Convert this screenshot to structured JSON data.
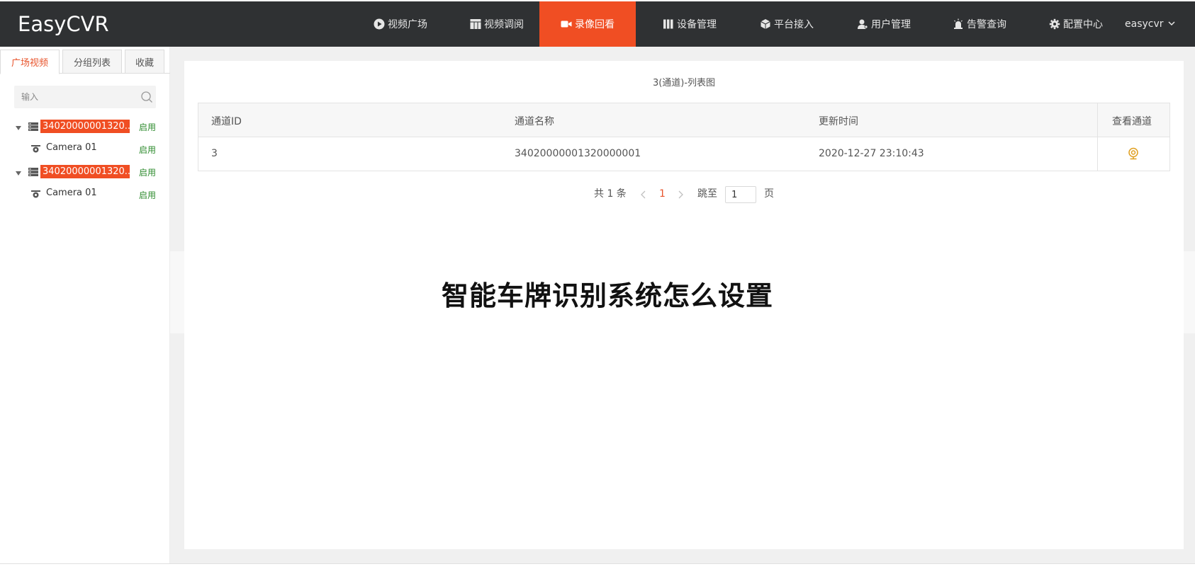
{
  "app": {
    "logo": "EasyCVR"
  },
  "nav": {
    "items": [
      {
        "label": "视频广场",
        "icon": "play-circle-icon"
      },
      {
        "label": "视频调阅",
        "icon": "grid-icon"
      },
      {
        "label": "录像回看",
        "icon": "video-camera-icon",
        "active": true
      },
      {
        "label": "设备管理",
        "icon": "columns-icon"
      },
      {
        "label": "平台接入",
        "icon": "cube-icon"
      },
      {
        "label": "用户管理",
        "icon": "user-icon"
      },
      {
        "label": "告警查询",
        "icon": "alarm-icon"
      },
      {
        "label": "配置中心",
        "icon": "gear-icon"
      }
    ],
    "user": "easycvr"
  },
  "sidebar": {
    "tabs": [
      {
        "label": "广场视频",
        "active": true
      },
      {
        "label": "分组列表"
      },
      {
        "label": "收藏"
      }
    ],
    "search_placeholder": "输入",
    "tree": [
      {
        "type": "device",
        "label": "34020000001320...",
        "status": "启用"
      },
      {
        "type": "camera",
        "label": "Camera 01",
        "status": "启用"
      },
      {
        "type": "device",
        "label": "34020000001320...",
        "status": "启用"
      },
      {
        "type": "camera",
        "label": "Camera 01",
        "status": "启用"
      }
    ]
  },
  "main": {
    "title": "3(通道)-列表图",
    "table": {
      "headers": [
        "通道ID",
        "通道名称",
        "更新时间",
        "查看通道"
      ],
      "rows": [
        {
          "id": "3",
          "name": "34020000001320000001",
          "updated": "2020-12-27 23:10:43",
          "action_icon": "webcam-icon"
        }
      ]
    },
    "pager": {
      "total_label": "共 1 条",
      "current_page": "1",
      "jump_label": "跳至",
      "jump_value": "1",
      "page_suffix": "页"
    }
  },
  "overlay": {
    "text": "智能车牌识别系统怎么设置"
  },
  "colors": {
    "topbar": "#2f3133",
    "accent": "#f04e23",
    "status_green": "#2e8b2e",
    "view_icon": "#e0a020"
  }
}
